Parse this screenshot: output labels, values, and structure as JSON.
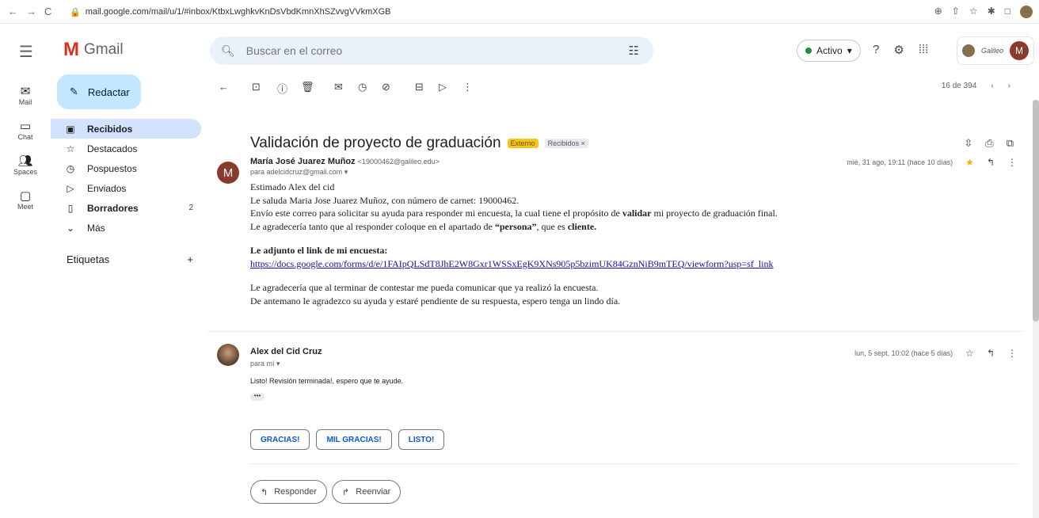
{
  "browser": {
    "url": "mail.google.com/mail/u/1/#inbox/KtbxLwghkvKnDsVbdKmnXhSZvvgVVkmXGB"
  },
  "header": {
    "app_name": "Gmail",
    "search_placeholder": "Buscar en el correo",
    "status_label": "Activo",
    "account_org": "Galileo",
    "avatar_letter": "M"
  },
  "rail": {
    "items": [
      {
        "label": "Mail",
        "icon": "mail-icon"
      },
      {
        "label": "Chat",
        "icon": "chat-icon"
      },
      {
        "label": "Spaces",
        "icon": "spaces-icon"
      },
      {
        "label": "Meet",
        "icon": "meet-icon"
      }
    ]
  },
  "sidebar": {
    "compose_label": "Redactar",
    "items": [
      {
        "label": "Recibidos",
        "icon": "inbox-icon"
      },
      {
        "label": "Destacados",
        "icon": "star-icon"
      },
      {
        "label": "Pospuestos",
        "icon": "clock-icon"
      },
      {
        "label": "Enviados",
        "icon": "send-icon"
      },
      {
        "label": "Borradores",
        "icon": "draft-icon",
        "count": "2"
      },
      {
        "label": "Más",
        "icon": "chevron-down-icon"
      }
    ],
    "labels_title": "Etiquetas"
  },
  "toolbar": {
    "pager_text": "16 de 394"
  },
  "thread": {
    "subject": "Validación de proyecto de graduación",
    "tag_external": "Externo",
    "tag_inbox": "Recibidos ×"
  },
  "message1": {
    "avatar_letter": "M",
    "sender_name": "María José Juarez Muñoz",
    "sender_email": "<19000462@galileo.edu>",
    "to": "para adelcidcruz@gmail.com",
    "date": "mié, 31 ago, 19:11 (hace 10 días)",
    "greeting": "Estimado Alex del cid",
    "line1": "Le saluda Maria Jose Juarez Muñoz, con número de carnet: 19000462.",
    "line2_a": "Envío este correo para solicitar su ayuda para responder mi encuesta, la cual tiene el propósito de ",
    "line2_b": "validar",
    "line2_c": " mi proyecto de graduación final.",
    "line3_a": "Le agradecería tanto que al responder coloque en el apartado de ",
    "line3_b": "“persona”",
    "line3_c": ", que es ",
    "line3_d": "cliente.",
    "link_heading": "Le adjunto el link de mi encuesta:",
    "link": "https://docs.google.com/forms/d/e/1FAIpQLSdT8JhE2W8Gxr1WSSxEgK9XNs905p5bzimUK84GznNiB9mTEQ/viewform?usp=sf_link",
    "line4": "Le agradecería que al terminar de contestar me pueda comunicar que ya realizó la encuesta.",
    "line5": "De antemano le agradezco su ayuda y estaré pendiente de su respuesta, espero tenga un lindo día."
  },
  "message2": {
    "sender_name": "Alex del Cid Cruz",
    "to": "para mí",
    "date": "lun, 5 sept, 10:02 (hace 5 días)",
    "body": "Listo! Revisión terminada!, espero que te ayude.",
    "dots": "•••"
  },
  "smart_replies": [
    "GRACIAS!",
    "MIL GRACIAS!",
    "LISTO!"
  ],
  "actions": {
    "reply": "Responder",
    "forward": "Reenviar"
  }
}
